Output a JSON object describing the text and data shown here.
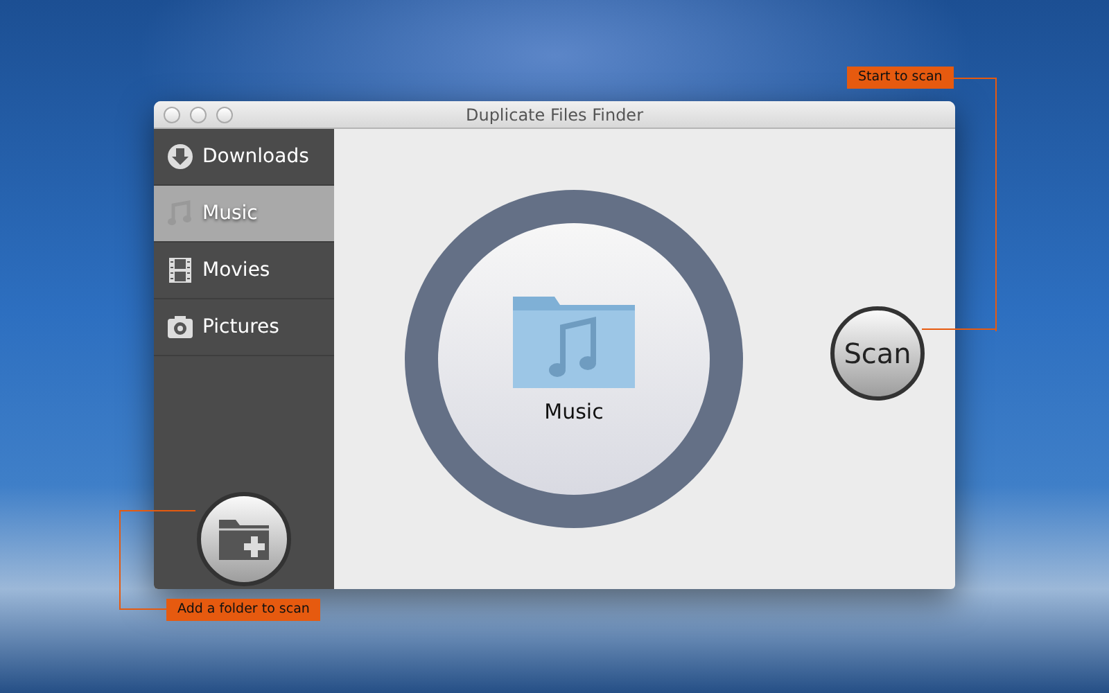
{
  "window": {
    "title": "Duplicate Files Finder"
  },
  "sidebar": {
    "items": [
      {
        "label": "Downloads",
        "kind": "downloads",
        "selected": false
      },
      {
        "label": "Music",
        "kind": "music",
        "selected": true
      },
      {
        "label": "Movies",
        "kind": "movies",
        "selected": false
      },
      {
        "label": "Pictures",
        "kind": "pictures",
        "selected": false
      }
    ]
  },
  "main": {
    "folder_label": "Music",
    "scan_button": "Scan"
  },
  "callouts": [
    {
      "kind": "scan",
      "text": "Start to scan"
    },
    {
      "kind": "add",
      "text": "Add a folder to scan"
    }
  ]
}
